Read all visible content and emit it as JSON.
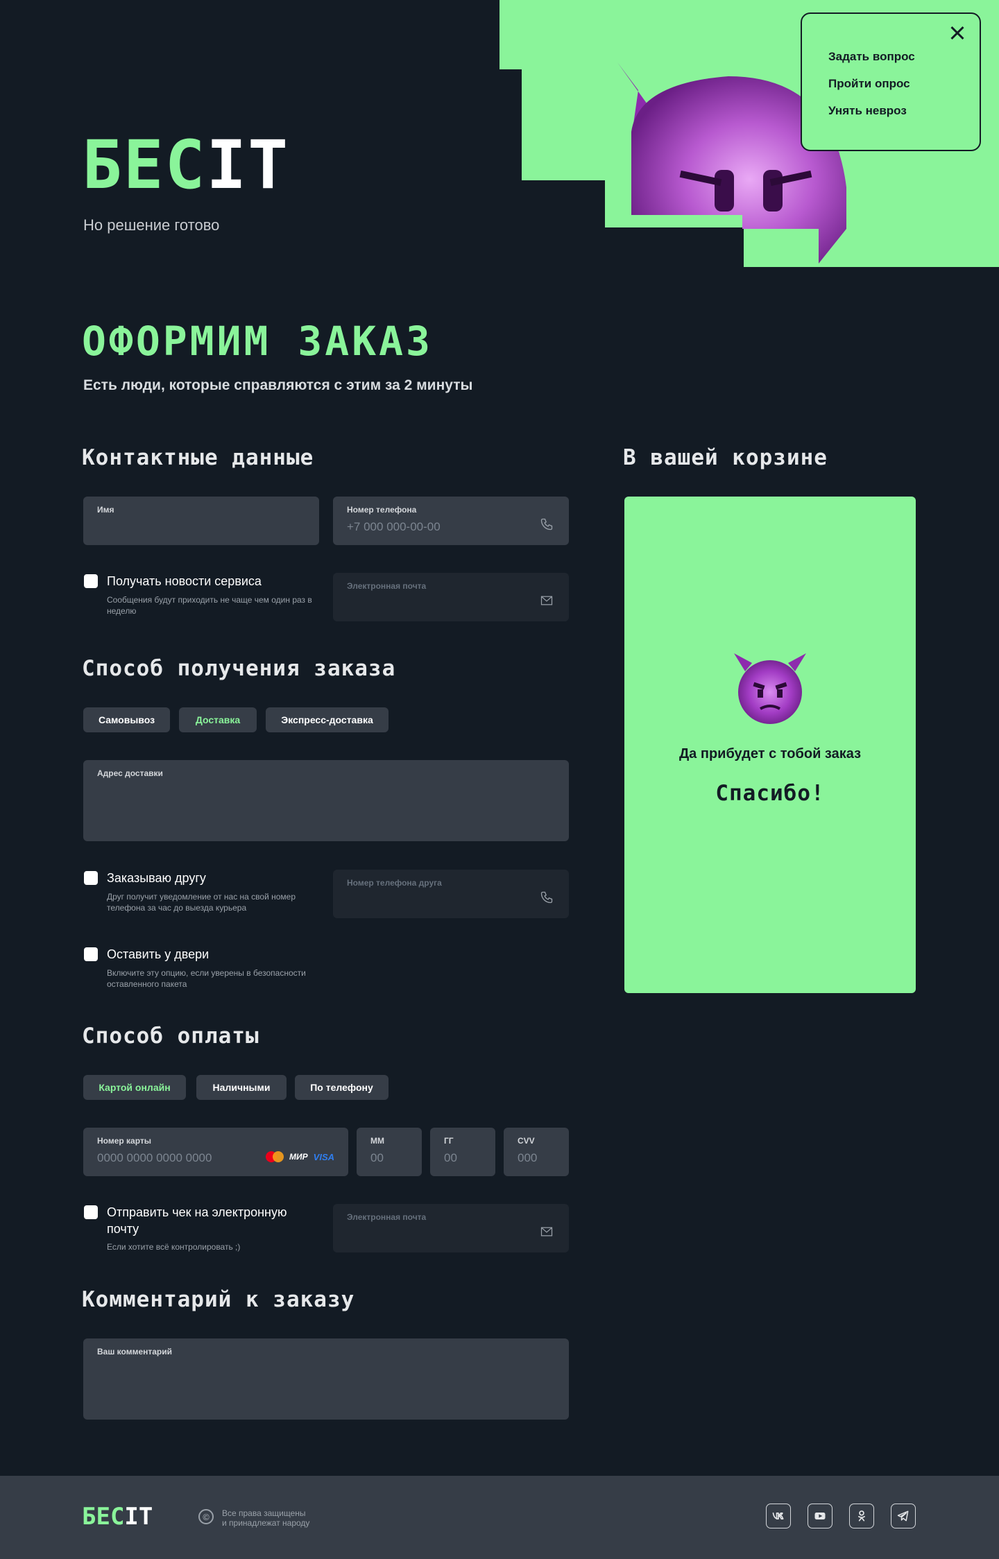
{
  "brand": {
    "logo_green": "БЕС",
    "logo_white": "IT",
    "tagline": "Но решение готово"
  },
  "popup": {
    "items": [
      "Задать вопрос",
      "Пройти опрос",
      "Унять невроз"
    ]
  },
  "page": {
    "title": "ОФОРМИМ ЗАКАЗ",
    "subtitle": "Есть люди, которые справляются с этим за 2 минуты"
  },
  "contacts": {
    "title": "Контактные данные",
    "name": {
      "label": "Имя",
      "value": ""
    },
    "phone": {
      "label": "Номер телефона",
      "placeholder": "+7 000 000-00-00"
    },
    "news": {
      "label": "Получать новости сервиса",
      "hint": "Сообщения будут приходить не чаще чем один раз в неделю"
    },
    "email": {
      "label": "Электронная почта"
    }
  },
  "delivery": {
    "title": "Способ получения заказа",
    "options": [
      "Самовывоз",
      "Доставка",
      "Экспресс-доставка"
    ],
    "selected": "Доставка",
    "address": {
      "label": "Адрес доставки"
    },
    "friend": {
      "label": "Заказываю другу",
      "hint": "Друг получит уведомление от нас на свой номер телефона за час до выезда курьера"
    },
    "friend_phone": {
      "label": "Номер телефона друга"
    },
    "door": {
      "label": "Оставить у двери",
      "hint": "Включите эту опцию, если уверены в безопасности оставленного пакета"
    }
  },
  "payment": {
    "title": "Способ оплаты",
    "options": [
      "Картой онлайн",
      "Наличными",
      "По телефону"
    ],
    "selected": "Картой онлайн",
    "card": {
      "label": "Номер карты",
      "placeholder": "0000 0000 0000 0000",
      "mir": "МИР",
      "visa": "VISA"
    },
    "mm": {
      "label": "ММ",
      "placeholder": "00"
    },
    "yy": {
      "label": "ГГ",
      "placeholder": "00"
    },
    "cvv": {
      "label": "CVV",
      "placeholder": "000"
    },
    "receipt": {
      "label": "Отправить чек на электронную почту",
      "hint": "Если хотите всё контролировать ;)"
    },
    "receipt_email": {
      "label": "Электронная почта"
    }
  },
  "comment": {
    "title": "Комментарий к заказу",
    "label": "Ваш комментарий"
  },
  "cart": {
    "title": "В вашей корзине",
    "line1": "Да прибудет с тобой заказ",
    "line2": "Спасибо!"
  },
  "footer": {
    "logo_green": "БЕС",
    "logo_white": "IT",
    "copyright_symbol": "©",
    "rights_line1": "Все права защищены",
    "rights_line2": "и принадлежат народу",
    "socials": [
      "vk-icon",
      "youtube-icon",
      "odnoklassniki-icon",
      "telegram-icon"
    ]
  },
  "colors": {
    "background": "#131b24",
    "accent": "#8af49a",
    "field": "#363d47",
    "field_dim": "#1f262f",
    "devil": "#a23cc4"
  }
}
